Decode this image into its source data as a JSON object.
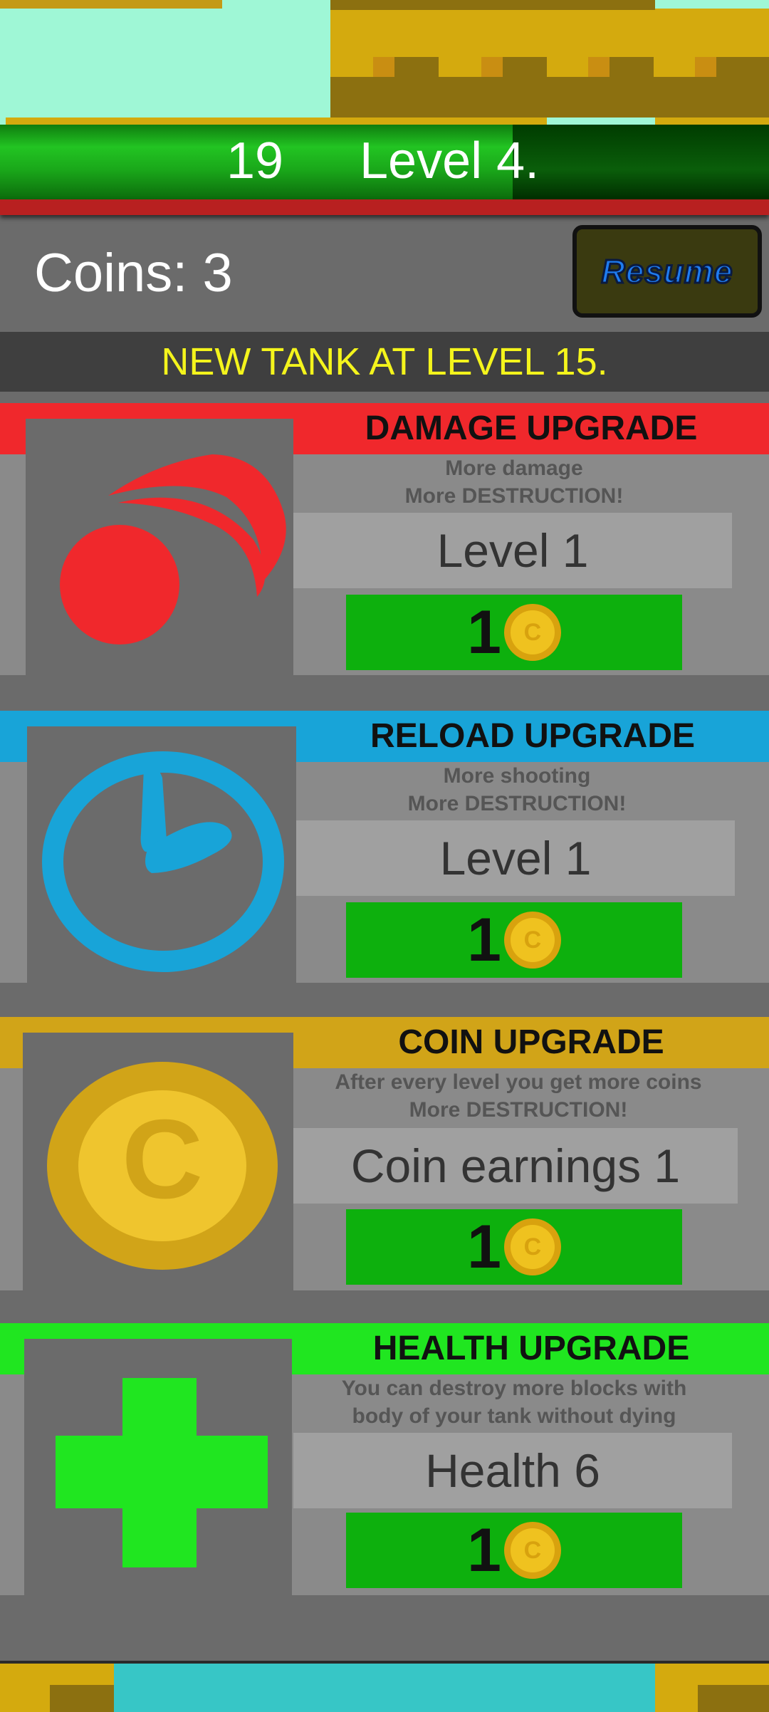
{
  "hud": {
    "score": "19",
    "level": "Level 4."
  },
  "coins": {
    "label": "Coins: 3"
  },
  "resume": {
    "label": "Resume"
  },
  "banner": {
    "text": "NEW TANK AT LEVEL 15."
  },
  "upgrades": [
    {
      "title": "DAMAGE UPGRADE",
      "desc1": "More damage",
      "desc2": "More DESTRUCTION!",
      "level_text": "Level  1",
      "price": "1",
      "color": "#f0282c",
      "icon": "damage-icon"
    },
    {
      "title": "RELOAD UPGRADE",
      "desc1": "More shooting",
      "desc2": "More DESTRUCTION!",
      "level_text": "Level  1",
      "price": "1",
      "color": "#18a4d8",
      "icon": "clock-icon"
    },
    {
      "title": "COIN UPGRADE",
      "desc1": "After every level you get more coins",
      "desc2": "More DESTRUCTION!",
      "level_text": "Coin earnings  1",
      "price": "1",
      "color": "#d1a418",
      "icon": "coin-icon"
    },
    {
      "title": "HEALTH UPGRADE",
      "desc1": "You can destroy more blocks with",
      "desc2": "body of your tank without dying",
      "level_text": "Health  6",
      "price": "1",
      "color": "#20e620",
      "icon": "plus-icon"
    }
  ],
  "coin_glyph": "C",
  "colors": {
    "buy_button": "#0db00d",
    "banner_text": "#f4f41c",
    "resume_text": "#1e7cf0"
  }
}
